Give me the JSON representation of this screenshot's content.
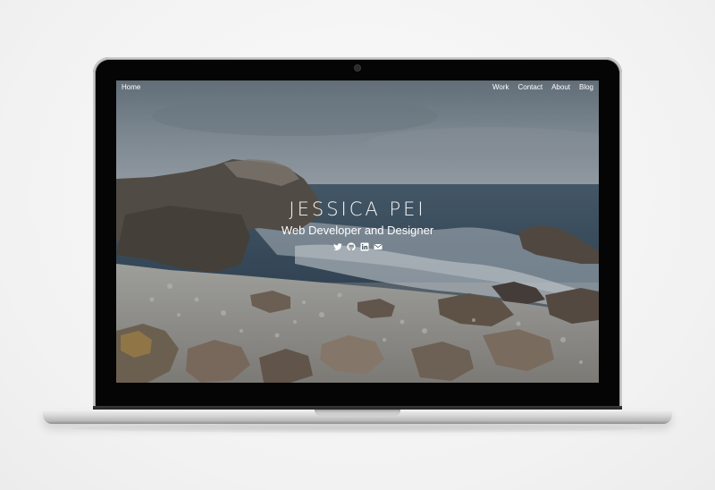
{
  "nav": {
    "home": "Home",
    "links": [
      "Work",
      "Contact",
      "About",
      "Blog"
    ]
  },
  "hero": {
    "name": "JESSICA PEI",
    "role": "Web Developer and Designer",
    "social_icons": [
      "twitter-icon",
      "github-icon",
      "linkedin-icon",
      "email-icon"
    ]
  },
  "colors": {
    "text": "#ffffff",
    "sky": "#7d8a94",
    "sea": "#3f5566",
    "rock": "#6b5a4a",
    "bezel": "#0c0c0c",
    "aluminum": "#d9d9d9"
  }
}
